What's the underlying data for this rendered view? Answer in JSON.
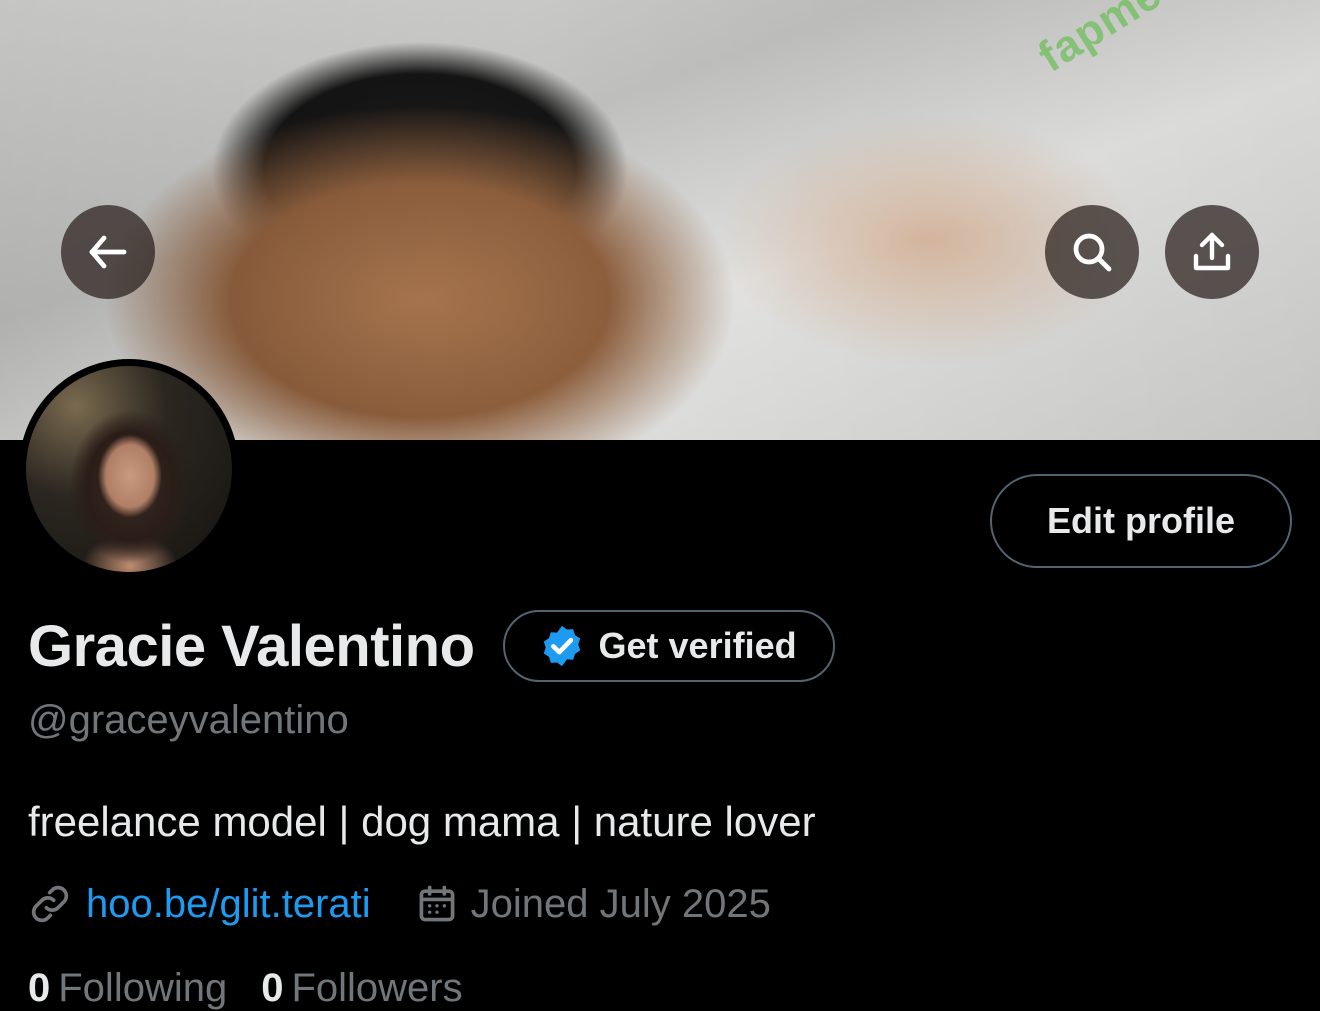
{
  "header": {
    "back_icon": "arrow-left-icon",
    "search_icon": "search-icon",
    "share_icon": "share-upload-icon",
    "watermark": "fapmenu.com"
  },
  "profile": {
    "display_name": "Gracie Valentino",
    "handle": "@graceyvalentino",
    "bio": "freelance model | dog mama | nature lover",
    "link": "hoo.be/glit.terati",
    "joined": "Joined July 2025",
    "edit_label": "Edit profile",
    "verify_label": "Get verified",
    "following_count": "0",
    "following_label": "Following",
    "followers_count": "0",
    "followers_label": "Followers"
  },
  "colors": {
    "background": "#000000",
    "text_primary": "#e7e9ea",
    "text_secondary": "#71767b",
    "link": "#1d9bf0",
    "verified_badge": "#1d9bf0",
    "border": "#536471"
  }
}
